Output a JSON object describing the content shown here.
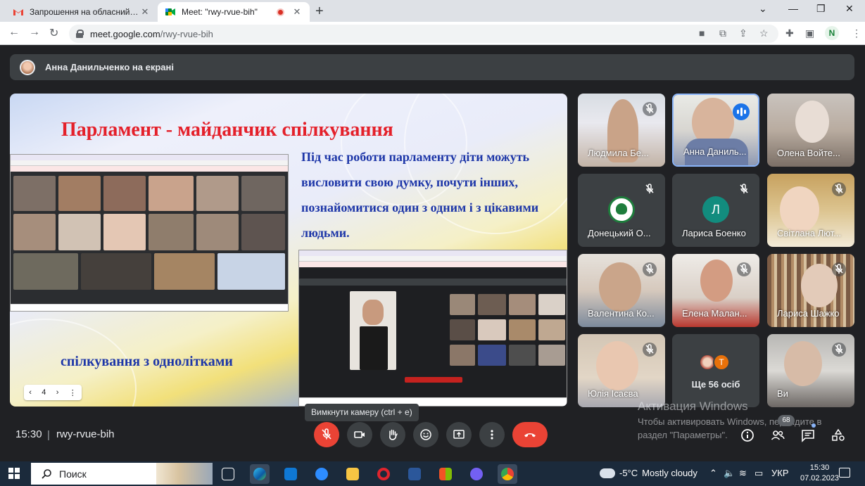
{
  "browser": {
    "tabs": [
      {
        "title": "Запрошення на обласний семі",
        "active": false
      },
      {
        "title": "Meet: \"rwy-rvue-bih\"",
        "active": true
      }
    ],
    "url_host": "meet.google.com",
    "url_path": "/rwy-rvue-bih",
    "profile_initial": "N"
  },
  "meet": {
    "presenting_banner": "Анна Данильченко на екрані",
    "slide": {
      "title": "Парламент - майданчик спілкування",
      "body": "Під час роботи парламенту діти можуть висловити свою думку, почути інших, познайомитися один з одним і з цікавими людьми.",
      "footer": "спілкування з однолітками",
      "page": "4"
    },
    "participants": [
      {
        "name": "Людмила Бе...",
        "muted": true
      },
      {
        "name": "Анна Даниль...",
        "muted": false,
        "speaking": true
      },
      {
        "name": "Олена Войте..."
      },
      {
        "name": "Донецький О...",
        "muted": true
      },
      {
        "name": "Лариса Боенко",
        "muted": true,
        "initial": "Л"
      },
      {
        "name": "Світлана Лют...",
        "muted": true
      },
      {
        "name": "Валентина Ко...",
        "muted": true
      },
      {
        "name": "Елена Малан...",
        "muted": true
      },
      {
        "name": "Лариса Шажко",
        "muted": true
      },
      {
        "name": "Юлія Ісаєва",
        "muted": true
      },
      {
        "name": "Ще 56 осіб",
        "initial": "T"
      },
      {
        "name": "Ви",
        "muted": true
      }
    ],
    "tooltip": "Вимкнути камеру (ctrl + e)",
    "time": "15:30",
    "separator": "|",
    "meeting_code": "rwy-rvue-bih",
    "people_count": "68",
    "watermark_title": "Активация Windows",
    "watermark_text": "Чтобы активировать Windows, перейдите в раздел \"Параметры\"."
  },
  "taskbar": {
    "search_label": "Поиск",
    "weather_temp": "-5°C",
    "weather_text": "Mostly cloudy",
    "language": "УКР",
    "clock_time": "15:30",
    "clock_date": "07.02.2023"
  },
  "colors": {
    "meet_bg": "#202124",
    "end_call": "#ea4335",
    "slide_title": "#e4202a",
    "slide_text": "#1d36a8",
    "speaking_outline": "#8ab4f8"
  }
}
